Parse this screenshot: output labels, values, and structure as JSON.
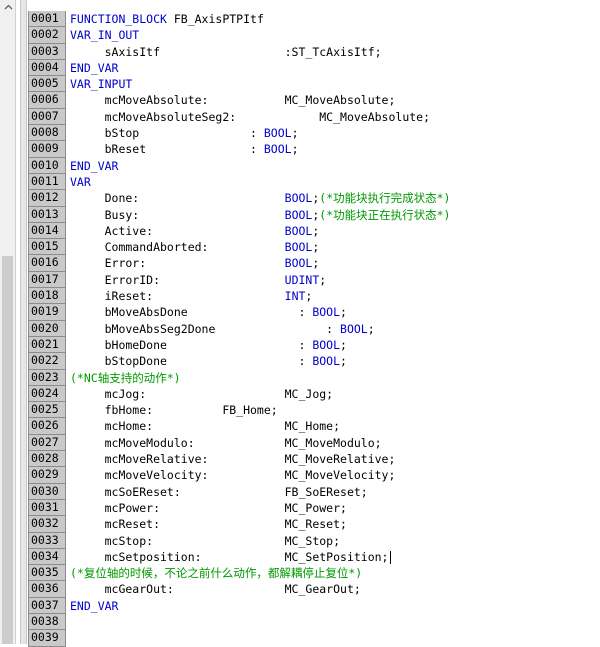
{
  "lines": [
    {
      "num": "0001",
      "segs": [
        {
          "t": "FUNCTION_BLOCK",
          "k": "kw"
        },
        {
          "t": " FB_AxisPTPItf",
          "k": ""
        }
      ]
    },
    {
      "num": "0002",
      "segs": [
        {
          "t": "VAR_IN_OUT",
          "k": "kw"
        }
      ]
    },
    {
      "num": "0003",
      "segs": [
        {
          "t": "     sAxisItf                  :ST_TcAxisItf;",
          "k": ""
        }
      ]
    },
    {
      "num": "0004",
      "segs": [
        {
          "t": "END_VAR",
          "k": "kw"
        }
      ]
    },
    {
      "num": "0005",
      "segs": [
        {
          "t": "VAR_INPUT",
          "k": "kw"
        }
      ]
    },
    {
      "num": "0006",
      "segs": [
        {
          "t": "     mcMoveAbsolute:           MC_MoveAbsolute;",
          "k": ""
        }
      ]
    },
    {
      "num": "0007",
      "segs": [
        {
          "t": "     mcMoveAbsoluteSeg2:            MC_MoveAbsolute;",
          "k": ""
        }
      ]
    },
    {
      "num": "0008",
      "segs": [
        {
          "t": "     bStop                : ",
          "k": ""
        },
        {
          "t": "BOOL",
          "k": "kw"
        },
        {
          "t": ";",
          "k": ""
        }
      ]
    },
    {
      "num": "0009",
      "segs": [
        {
          "t": "     bReset               : ",
          "k": ""
        },
        {
          "t": "BOOL",
          "k": "kw"
        },
        {
          "t": ";",
          "k": ""
        }
      ]
    },
    {
      "num": "0010",
      "segs": [
        {
          "t": "END_VAR",
          "k": "kw"
        }
      ]
    },
    {
      "num": "0011",
      "segs": [
        {
          "t": "VAR",
          "k": "kw"
        }
      ]
    },
    {
      "num": "0012",
      "segs": [
        {
          "t": "     Done:                     ",
          "k": ""
        },
        {
          "t": "BOOL",
          "k": "kw"
        },
        {
          "t": ";",
          "k": ""
        },
        {
          "t": "(*功能块执行完成状态*)",
          "k": "cm"
        }
      ]
    },
    {
      "num": "0013",
      "segs": [
        {
          "t": "     Busy:                     ",
          "k": ""
        },
        {
          "t": "BOOL",
          "k": "kw"
        },
        {
          "t": ";",
          "k": ""
        },
        {
          "t": "(*功能块正在执行状态*)",
          "k": "cm"
        }
      ]
    },
    {
      "num": "0014",
      "segs": [
        {
          "t": "     Active:                   ",
          "k": ""
        },
        {
          "t": "BOOL",
          "k": "kw"
        },
        {
          "t": ";",
          "k": ""
        }
      ]
    },
    {
      "num": "0015",
      "segs": [
        {
          "t": "     CommandAborted:           ",
          "k": ""
        },
        {
          "t": "BOOL",
          "k": "kw"
        },
        {
          "t": ";",
          "k": ""
        }
      ]
    },
    {
      "num": "0016",
      "segs": [
        {
          "t": "     Error:                    ",
          "k": ""
        },
        {
          "t": "BOOL",
          "k": "kw"
        },
        {
          "t": ";",
          "k": ""
        }
      ]
    },
    {
      "num": "0017",
      "segs": [
        {
          "t": "     ErrorID:                  ",
          "k": ""
        },
        {
          "t": "UDINT",
          "k": "kw"
        },
        {
          "t": ";",
          "k": ""
        }
      ]
    },
    {
      "num": "0018",
      "segs": [
        {
          "t": "     iReset:                   ",
          "k": ""
        },
        {
          "t": "INT",
          "k": "kw"
        },
        {
          "t": ";",
          "k": ""
        }
      ]
    },
    {
      "num": "0019",
      "segs": [
        {
          "t": "     bMoveAbsDone                : ",
          "k": ""
        },
        {
          "t": "BOOL",
          "k": "kw"
        },
        {
          "t": ";",
          "k": ""
        }
      ]
    },
    {
      "num": "0020",
      "segs": [
        {
          "t": "     bMoveAbsSeg2Done                : ",
          "k": ""
        },
        {
          "t": "BOOL",
          "k": "kw"
        },
        {
          "t": ";",
          "k": ""
        }
      ]
    },
    {
      "num": "0021",
      "segs": [
        {
          "t": "     bHomeDone                   : ",
          "k": ""
        },
        {
          "t": "BOOL",
          "k": "kw"
        },
        {
          "t": ";",
          "k": ""
        }
      ]
    },
    {
      "num": "0022",
      "segs": [
        {
          "t": "     bStopDone                   : ",
          "k": ""
        },
        {
          "t": "BOOL",
          "k": "kw"
        },
        {
          "t": ";",
          "k": ""
        }
      ]
    },
    {
      "num": "0023",
      "segs": [
        {
          "t": "(*NC轴支持的动作*)",
          "k": "cm"
        }
      ]
    },
    {
      "num": "0024",
      "segs": [
        {
          "t": "     mcJog:                    MC_Jog;",
          "k": ""
        }
      ]
    },
    {
      "num": "0025",
      "segs": [
        {
          "t": "     fbHome:          FB_Home;",
          "k": ""
        }
      ]
    },
    {
      "num": "0026",
      "segs": [
        {
          "t": "     mcHome:                   MC_Home;",
          "k": ""
        }
      ]
    },
    {
      "num": "0027",
      "segs": [
        {
          "t": "     mcMoveModulo:             MC_MoveModulo;",
          "k": ""
        }
      ]
    },
    {
      "num": "0028",
      "segs": [
        {
          "t": "     mcMoveRelative:           MC_MoveRelative;",
          "k": ""
        }
      ]
    },
    {
      "num": "0029",
      "segs": [
        {
          "t": "     mcMoveVelocity:           MC_MoveVelocity;",
          "k": ""
        }
      ]
    },
    {
      "num": "0030",
      "segs": [
        {
          "t": "     mcSoEReset:               FB_SoEReset;",
          "k": ""
        }
      ]
    },
    {
      "num": "0031",
      "segs": [
        {
          "t": "     mcPower:                  MC_Power;",
          "k": ""
        }
      ]
    },
    {
      "num": "0032",
      "segs": [
        {
          "t": "     mcReset:                  MC_Reset;",
          "k": ""
        }
      ]
    },
    {
      "num": "0033",
      "segs": [
        {
          "t": "     mcStop:                   MC_Stop;",
          "k": ""
        }
      ]
    },
    {
      "num": "0034",
      "segs": [
        {
          "t": "     mcSetposition:            MC_SetPosition;",
          "k": ""
        }
      ],
      "caret": true
    },
    {
      "num": "0035",
      "segs": [
        {
          "t": "(*复位轴的时候，不论之前什么动作，都解耦停止复位*)",
          "k": "cm"
        }
      ]
    },
    {
      "num": "0036",
      "segs": [
        {
          "t": "     mcGearOut:                MC_GearOut;",
          "k": ""
        }
      ]
    },
    {
      "num": "0037",
      "segs": [
        {
          "t": "END_VAR",
          "k": "kw"
        }
      ]
    },
    {
      "num": "0038",
      "segs": []
    },
    {
      "num": "0039",
      "segs": []
    }
  ],
  "colors": {
    "keyword": "#0000cc",
    "comment": "#009900",
    "text": "#000000",
    "gutter": "#c9c9c9"
  },
  "icons": {
    "scroll_up": "chevron-up-icon"
  }
}
